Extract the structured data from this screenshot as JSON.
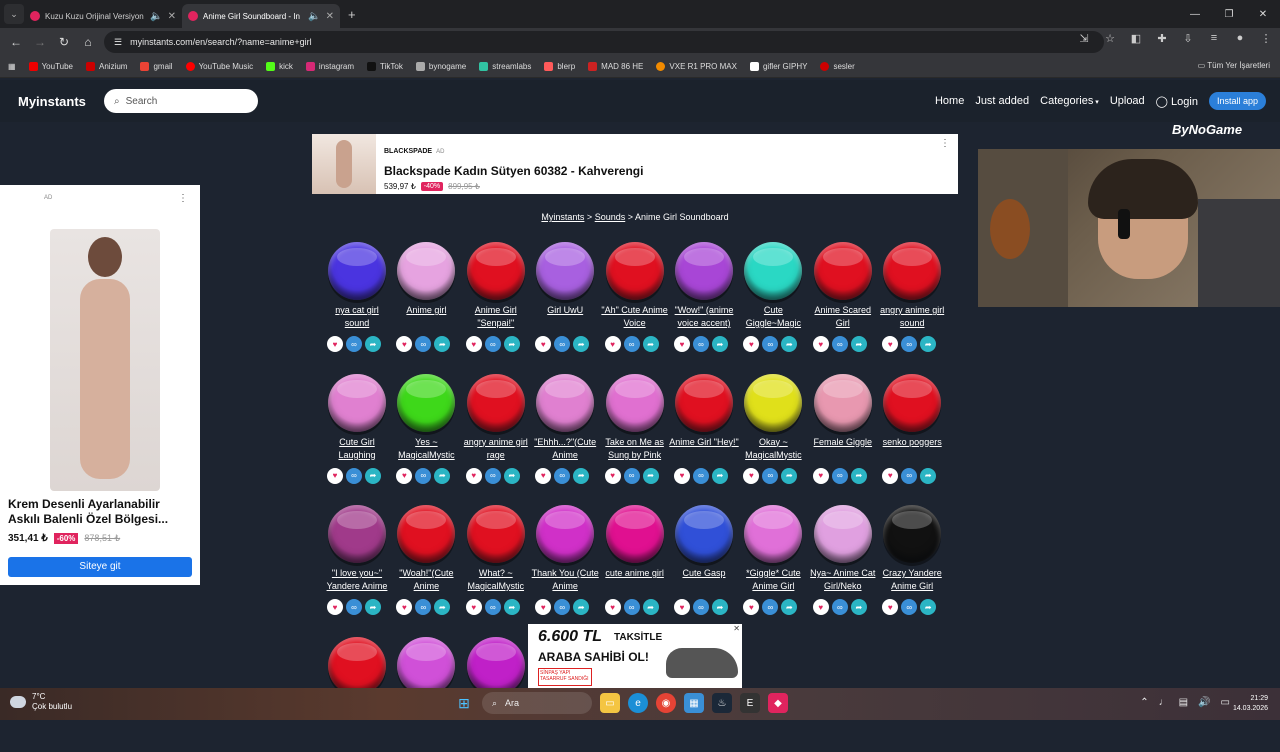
{
  "browser": {
    "tabs": [
      {
        "title": "Kuzu Kuzu Orijinal Versiyon",
        "active": false
      },
      {
        "title": "Anime Girl Soundboard - In",
        "active": true
      }
    ],
    "url": "myinstants.com/en/search/?name=anime+girl",
    "bookmarks": [
      "YouTube",
      "Anizium",
      "gmail",
      "YouTube Music",
      "kick",
      "instagram",
      "TikTok",
      "bynogame",
      "streamlabs",
      "blerp",
      "MAD 86 HE",
      "VXE R1 PRO MAX",
      "gifler GIPHY",
      "sesler"
    ],
    "bookmarks_all": "Tüm Yer İşaretleri"
  },
  "site": {
    "brand": "Myinstants",
    "search_placeholder": "Search",
    "menu": {
      "home": "Home",
      "just_added": "Just added",
      "categories": "Categories",
      "upload": "Upload",
      "login": "Login",
      "install": "Install app"
    }
  },
  "top_ad": {
    "brand": "BLACKSPADE",
    "ad_label": "AD",
    "title": "Blackspade Kadın Sütyen 60382 - Kahverengi",
    "price": "539,97 ₺",
    "discount": "-40%",
    "old_price": "899,95 ₺"
  },
  "side_ad": {
    "ad_label": "AD",
    "title": "Krem Desenli Ayarlanabilir Askılı Balenli Özel Bölgesi...",
    "price": "351,41 ₺",
    "discount": "-60%",
    "old_price": "878,51 ₺",
    "cta": "Siteye git"
  },
  "bynogame": "ByNoGame",
  "breadcrumb": {
    "home": "Myinstants",
    "sep1": ">",
    "sounds": "Sounds",
    "sep2": ">",
    "current": "Anime Girl Soundboard"
  },
  "sounds": [
    {
      "label": "nya cat girl sound",
      "color": "#4a34e0"
    },
    {
      "label": "Anime girl",
      "color": "#e6a3e0"
    },
    {
      "label": "Anime Girl \"Senpai!\"",
      "color": "#e01020"
    },
    {
      "label": "Girl UwU",
      "color": "#a860e0"
    },
    {
      "label": "\"Ah\" Cute Anime Voice",
      "color": "#e01020"
    },
    {
      "label": "\"Wow!\" (anime voice accent)",
      "color": "#a846d6"
    },
    {
      "label": "Cute Giggle~Magic",
      "color": "#2ad8c4"
    },
    {
      "label": "Anime Scared Girl",
      "color": "#e01020"
    },
    {
      "label": "angry anime girl sound",
      "color": "#e01020"
    },
    {
      "label": "Cute Girl Laughing",
      "color": "#e080d0"
    },
    {
      "label": "Yes ~ MagicalMystic",
      "color": "#3ed81a"
    },
    {
      "label": "angry anime girl rage",
      "color": "#e01020"
    },
    {
      "label": "\"Ehhh...?\"(Cute Anime",
      "color": "#e080d0"
    },
    {
      "label": "Take on Me as Sung by Pink",
      "color": "#e070d0"
    },
    {
      "label": "Anime Girl \"Hey!\"",
      "color": "#e01020"
    },
    {
      "label": "Okay ~ MagicalMystic",
      "color": "#e0e01a"
    },
    {
      "label": "Female Giggle",
      "color": "#e898b0"
    },
    {
      "label": "senko poggers",
      "color": "#e01020"
    },
    {
      "label": "\"I love you~\" Yandere Anime",
      "color": "#a03a8a"
    },
    {
      "label": "\"Woah!\"(Cute Anime",
      "color": "#e01020"
    },
    {
      "label": "What? ~ MagicalMystic",
      "color": "#e01020"
    },
    {
      "label": "Thank You (Cute Anime",
      "color": "#d030c8"
    },
    {
      "label": "cute anime girl",
      "color": "#e01090"
    },
    {
      "label": "Cute Gasp",
      "color": "#3050d8"
    },
    {
      "label": "*Giggle* Cute Anime Girl",
      "color": "#e070d8"
    },
    {
      "label": "Nya~ Anime Cat Girl/Neko",
      "color": "#e0a0e0"
    },
    {
      "label": "Crazy Yandere Anime Girl",
      "color": "#111111"
    },
    {
      "label": "",
      "color": "#e01020"
    },
    {
      "label": "",
      "color": "#d050d8"
    },
    {
      "label": "",
      "color": "#c020c8"
    },
    {
      "label": "",
      "color": "#e070b0"
    },
    {
      "label": "",
      "color": "#c040d8"
    },
    {
      "label": "",
      "color": "#a020d0"
    }
  ],
  "bottom_ad": {
    "big": "6.600 TL",
    "line1": "TAKSİTLE",
    "line2": "ARABA SAHİBİ OL!",
    "brand": "SİNPAŞ YAPI TASARRUF SANDIĞI"
  },
  "taskbar": {
    "temp": "7°C",
    "weather": "Çok bulutlu",
    "search": "Ara",
    "time": "21:29",
    "date": "14.03.2026"
  }
}
